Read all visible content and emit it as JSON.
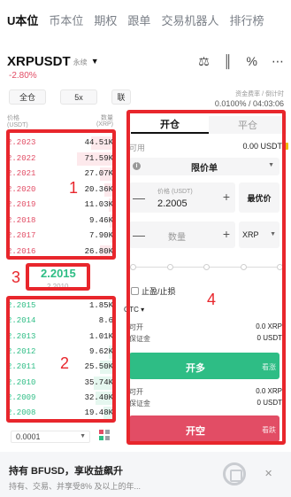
{
  "top_tabs": [
    "U本位",
    "币本位",
    "期权",
    "跟单",
    "交易机器人",
    "排行榜"
  ],
  "symbol": {
    "name": "XRPUSDT",
    "badge": "永续",
    "change": "-2.80%"
  },
  "controls": {
    "margin_mode": "全仓",
    "leverage": "5x",
    "mode": "联"
  },
  "funding": {
    "label": "资金费率 / 倒计时",
    "value": "0.0100% / 04:03:06"
  },
  "orderbook": {
    "header_price": "价格",
    "header_price_unit": "(USDT)",
    "header_qty": "数量",
    "header_qty_unit": "(XRP)",
    "asks": [
      {
        "price": "2.2023",
        "qty": "44.51K",
        "depth": 0.22
      },
      {
        "price": "2.2022",
        "qty": "71.59K",
        "depth": 0.35
      },
      {
        "price": "2.2021",
        "qty": "27.07K",
        "depth": 0.14
      },
      {
        "price": "2.2020",
        "qty": "20.36K",
        "depth": 0.1
      },
      {
        "price": "2.2019",
        "qty": "11.03K",
        "depth": 0.06
      },
      {
        "price": "2.2018",
        "qty": "9.46K",
        "depth": 0.05
      },
      {
        "price": "2.2017",
        "qty": "7.90K",
        "depth": 0.04
      },
      {
        "price": "2.2016",
        "qty": "26.80K",
        "depth": 0.14
      }
    ],
    "mid_price": "2.2015",
    "mid_sub": "2.2010",
    "bids": [
      {
        "price": "2.2015",
        "qty": "1.85K",
        "depth": 0.02
      },
      {
        "price": "2.2014",
        "qty": "8.6",
        "depth": 0.01
      },
      {
        "price": "2.2013",
        "qty": "1.01K",
        "depth": 0.02
      },
      {
        "price": "2.2012",
        "qty": "9.62K",
        "depth": 0.06
      },
      {
        "price": "2.2011",
        "qty": "25.50K",
        "depth": 0.14
      },
      {
        "price": "2.2010",
        "qty": "35.74K",
        "depth": 0.2
      },
      {
        "price": "2.2009",
        "qty": "32.40K",
        "depth": 0.18
      },
      {
        "price": "2.2008",
        "qty": "19.48K",
        "depth": 0.11
      }
    ],
    "precision": "0.0001"
  },
  "form": {
    "tab_open": "开仓",
    "tab_close": "平仓",
    "available_label": "可用",
    "available_value": "0.00 USDT",
    "order_type": "限价单",
    "price_label": "价格 (USDT)",
    "price_value": "2.2005",
    "best_price": "最优价",
    "qty_placeholder": "数量",
    "unit": "XRP",
    "tpsl_label": "止盈/止损",
    "tif": "GTC",
    "long_open_label": "可开",
    "long_open_value": "0.0 XRP",
    "long_margin_label": "保证金",
    "long_margin_value": "0 USDT",
    "long_button": "开多",
    "long_hint": "看涨",
    "short_open_label": "可开",
    "short_open_value": "0.0 XRP",
    "short_margin_label": "保证金",
    "short_margin_value": "0 USDT",
    "short_button": "开空",
    "short_hint": "看跌"
  },
  "banner": {
    "title": "持有 BFUSD，享收益飙升",
    "subtitle": "持有、交易、并享受8% 及以上的年..."
  },
  "annotations": [
    "1",
    "2",
    "3",
    "4"
  ],
  "colors": {
    "up": "#2ebd85",
    "down": "#e24d65",
    "annotation": "#e8262c"
  }
}
